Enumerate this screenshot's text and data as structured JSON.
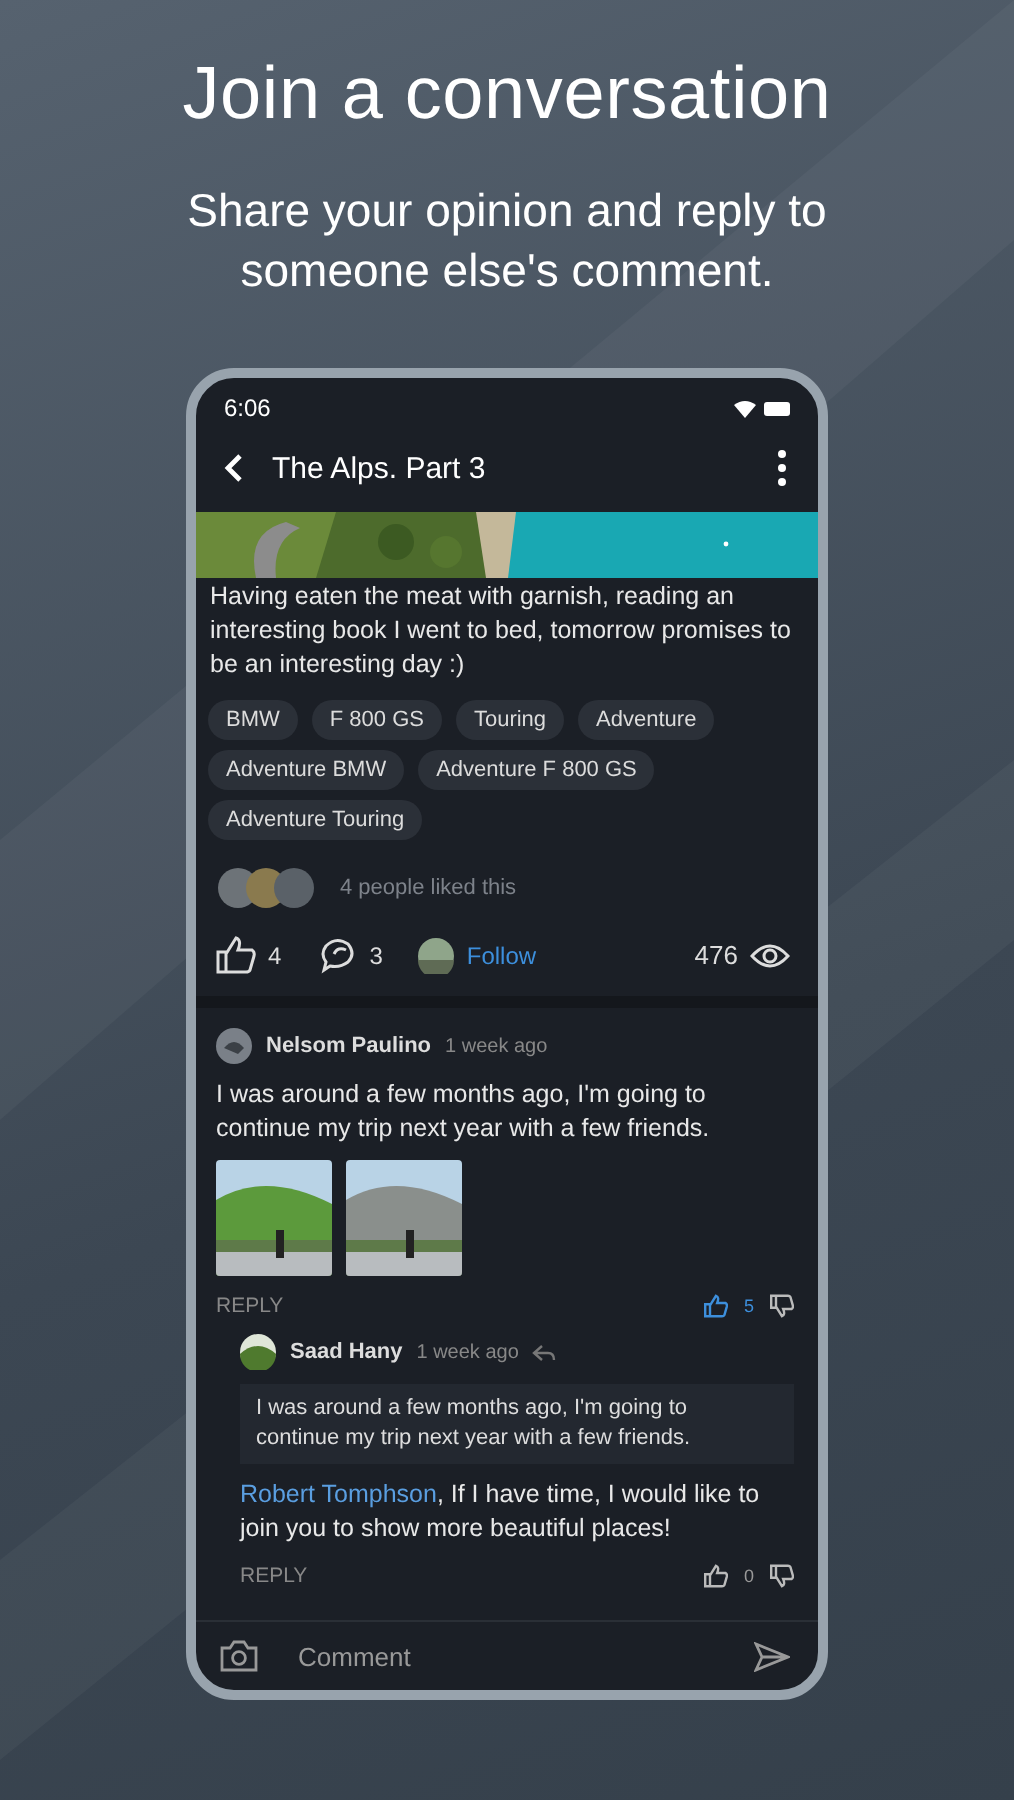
{
  "headline": "Join a conversation",
  "subtitle": "Share your opinion and reply to someone else's comment.",
  "status_bar": {
    "time": "6:06"
  },
  "header": {
    "title": "The Alps. Part 3"
  },
  "post": {
    "text": "Having eaten the meat with garnish, reading an interesting book I went to bed, tomorrow promises to be an interesting day :)",
    "tags": [
      "BMW",
      "F 800 GS",
      "Touring",
      "Adventure",
      "Adventure BMW",
      "Adventure F 800 GS",
      "Adventure Touring"
    ],
    "likes_text": "4 people liked this",
    "like_count": "4",
    "comment_count": "3",
    "follow": "Follow",
    "views": "476"
  },
  "comments": [
    {
      "author": "Nelsom Paulino",
      "time": "1 week ago",
      "text": "I was around a few months ago, I'm going to continue my trip next year with a few friends.",
      "photos": [
        {
          "kind": "picture"
        },
        {
          "kind": "picture"
        }
      ],
      "reply": "REPLY",
      "likes": "5",
      "liked": true,
      "replies": [
        {
          "author": "Saad Hany",
          "time": "1 week ago",
          "quote": "I was around a few months ago, I'm going to continue my trip next year with a few friends.",
          "mention": "Robert Tomphson",
          "text": ", If I have time, I would like to join you to show more beautiful places!",
          "reply": "REPLY",
          "likes": "0",
          "liked": false
        }
      ]
    }
  ],
  "composer": {
    "placeholder": "Comment"
  }
}
